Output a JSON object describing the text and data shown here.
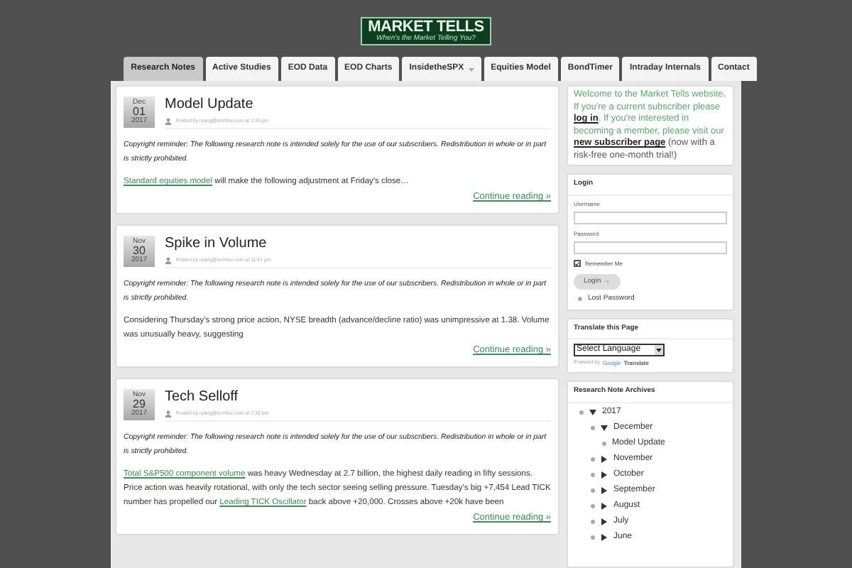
{
  "logo": {
    "title": "MARKET TELLS",
    "tagline": "When's the Market Telling You?"
  },
  "nav": [
    {
      "label": "Research Notes",
      "selected": true,
      "dropdown": false
    },
    {
      "label": "Active Studies",
      "selected": false,
      "dropdown": false
    },
    {
      "label": "EOD Data",
      "selected": false,
      "dropdown": false
    },
    {
      "label": "EOD Charts",
      "selected": false,
      "dropdown": false
    },
    {
      "label": "InsidetheSPX",
      "selected": false,
      "dropdown": true
    },
    {
      "label": "Equities Model",
      "selected": false,
      "dropdown": false
    },
    {
      "label": "BondTimer",
      "selected": false,
      "dropdown": false
    },
    {
      "label": "Intraday Internals",
      "selected": false,
      "dropdown": false
    },
    {
      "label": "Contact",
      "selected": false,
      "dropdown": false
    }
  ],
  "posts": [
    {
      "month": "Dec",
      "day": "01",
      "year": "2017",
      "title": "Model Update",
      "byline": "Posted by ryang@techfox.com at 1:35 pm",
      "notice": "Copyright reminder: The following research note is intended solely for the use of our subscribers. Redistribution in whole or in part is strictly prohibited.",
      "body": [
        {
          "kind": "link",
          "text": "Standard equities model"
        },
        {
          "kind": "text",
          "text": " will make the following adjustment at Friday's close…"
        }
      ],
      "more": "Continue reading »"
    },
    {
      "month": "Nov",
      "day": "30",
      "year": "2017",
      "title": "Spike in Volume",
      "byline": "Posted by ryang@techfox.com at 11:51 pm",
      "notice": "Copyright reminder: The following research note is intended solely for the use of our subscribers. Redistribution in whole or in part is strictly prohibited.",
      "body": [
        {
          "kind": "text",
          "text": "Considering Thursday's strong price action, NYSE breadth (advance/decline ratio) was unimpressive at 1.38. Volume was unusually heavy, suggesting"
        }
      ],
      "more": "Continue reading »"
    },
    {
      "month": "Nov",
      "day": "29",
      "year": "2017",
      "title": "Tech Selloff",
      "byline": "Posted by ryang@techfox.com at 7:30 pm",
      "notice": "Copyright reminder: The following research note is intended solely for the use of our subscribers. Redistribution in whole or in part is strictly prohibited.",
      "body": [
        {
          "kind": "link",
          "text": "Total S&P500 component volume"
        },
        {
          "kind": "text",
          "text": " was heavy Wednesday at 2.7 billion, the highest daily reading in fifty sessions. Price action was heavily rotational, with only the tech sector seeing selling pressure. Tuesday's big +7,454 Lead TICK number has propelled our "
        },
        {
          "kind": "link",
          "text": "Leading TICK Oscillator"
        },
        {
          "kind": "text",
          "text": " back above +20,000. Crosses above +20k have been"
        }
      ],
      "more": "Continue reading »"
    }
  ],
  "welcome": [
    {
      "kind": "text",
      "text": "Welcome to the Market Tells website. If you're a current subscriber please "
    },
    {
      "kind": "link",
      "text": "log in"
    },
    {
      "kind": "text",
      "text": ". If you're interested in becoming a member, please visit our "
    },
    {
      "kind": "link",
      "text": "new subscriber page"
    },
    {
      "kind": "plain",
      "text": " (now with a risk-free one-month trial!)"
    }
  ],
  "login": {
    "title": "Login",
    "username_label": "Username",
    "password_label": "Password",
    "remember": {
      "label": "Remember Me",
      "checked": true
    },
    "button": "Login →",
    "lost": "Lost Password"
  },
  "translate": {
    "title": "Translate this Page",
    "select": "Select Language",
    "powered": "Powered by",
    "google": "Google",
    "translate": "Translate"
  },
  "archives": {
    "title": "Research Note Archives",
    "items": [
      {
        "label": "2017",
        "expanded": true,
        "children": [
          {
            "label": "December",
            "expanded": true,
            "children": [
              {
                "label": "Model Update"
              }
            ]
          },
          {
            "label": "November",
            "expanded": false
          },
          {
            "label": "October",
            "expanded": false
          },
          {
            "label": "September",
            "expanded": false
          },
          {
            "label": "August",
            "expanded": false
          },
          {
            "label": "July",
            "expanded": false
          },
          {
            "label": "June",
            "expanded": false
          }
        ]
      }
    ]
  }
}
